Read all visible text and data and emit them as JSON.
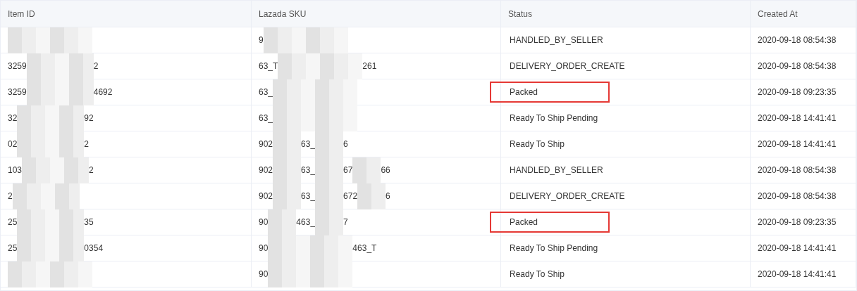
{
  "table": {
    "columns": [
      "Item ID",
      "Lazada SKU",
      "Status",
      "Created At"
    ],
    "rows": [
      {
        "item_id": [],
        "sku": [
          "9"
        ],
        "status": "HANDLED_BY_SELLER",
        "highlighted": false,
        "created_at": "2020-09-18 08:54:38"
      },
      {
        "item_id": [
          "3259",
          "2"
        ],
        "sku": [
          "63_T",
          "261"
        ],
        "status": "DELIVERY_ORDER_CREATE",
        "highlighted": false,
        "created_at": "2020-09-18 08:54:38"
      },
      {
        "item_id": [
          "3259",
          "4692"
        ],
        "sku": [
          "63_"
        ],
        "status": "Packed",
        "highlighted": true,
        "created_at": "2020-09-18 09:23:35"
      },
      {
        "item_id": [
          "32",
          "92"
        ],
        "sku": [
          "63_"
        ],
        "status": "Ready To Ship Pending",
        "highlighted": false,
        "created_at": "2020-09-18 14:41:41"
      },
      {
        "item_id": [
          "02",
          "2"
        ],
        "sku": [
          "902",
          "63_",
          "6"
        ],
        "status": "Ready To Ship",
        "highlighted": false,
        "created_at": "2020-09-18 14:41:41"
      },
      {
        "item_id": [
          "103",
          "2"
        ],
        "sku": [
          "902",
          "63_",
          "67",
          "66"
        ],
        "status": "HANDLED_BY_SELLER",
        "highlighted": false,
        "created_at": "2020-09-18 08:54:38"
      },
      {
        "item_id": [
          "2"
        ],
        "sku": [
          "902",
          "63_",
          "672",
          "6"
        ],
        "status": "DELIVERY_ORDER_CREATE",
        "highlighted": false,
        "created_at": "2020-09-18 08:54:38"
      },
      {
        "item_id": [
          "25",
          "35"
        ],
        "sku": [
          "90",
          "463_",
          "7"
        ],
        "status": "Packed",
        "highlighted": true,
        "created_at": "2020-09-18 09:23:35"
      },
      {
        "item_id": [
          "25",
          "0354"
        ],
        "sku": [
          "90",
          "463_T"
        ],
        "status": "Ready To Ship Pending",
        "highlighted": false,
        "created_at": "2020-09-18 14:41:41"
      },
      {
        "item_id": [],
        "sku": [
          "90"
        ],
        "status": "Ready To Ship",
        "highlighted": false,
        "created_at": "2020-09-18 14:41:41"
      }
    ]
  }
}
